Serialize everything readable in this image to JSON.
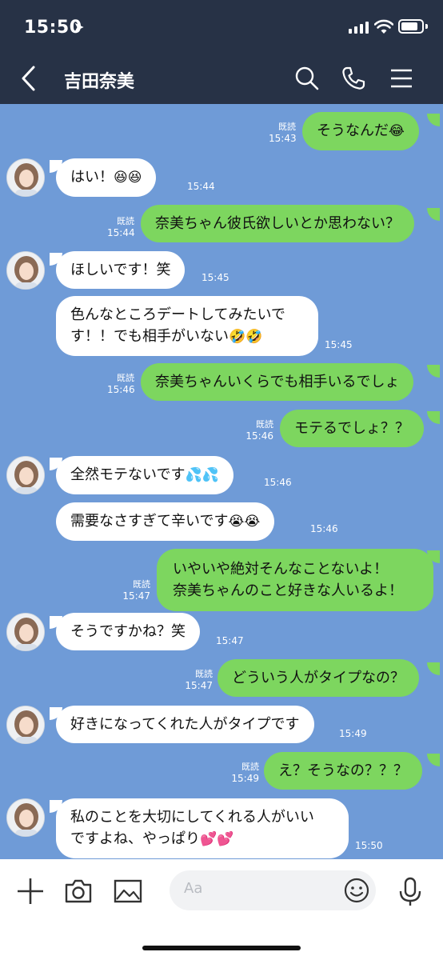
{
  "status_bar": {
    "time": "15:50"
  },
  "header": {
    "contact_name": "吉田奈美"
  },
  "messages": [
    {
      "dir": "out",
      "text": "そうなんだ",
      "emoji": "😂",
      "read": "既読",
      "time": "15:43"
    },
    {
      "dir": "in",
      "text": "はい！",
      "emoji": "😆😆",
      "time": "15:44"
    },
    {
      "dir": "out",
      "text": "奈美ちゃん彼氏欲しいとか思わない？",
      "emoji": "",
      "read": "既読",
      "time": "15:44"
    },
    {
      "dir": "in",
      "text": "ほしいです！笑",
      "emoji": "",
      "time": "15:45"
    },
    {
      "dir": "in",
      "line1": "色んなところデートしてみたいで",
      "line2": "す！！でも相手がいない",
      "emoji": "🤣🤣",
      "time": "15:45"
    },
    {
      "dir": "out",
      "text": "奈美ちゃんいくらでも相手いるでしょ",
      "emoji": "",
      "read": "既読",
      "time": "15:46"
    },
    {
      "dir": "out",
      "text": "モテるでしょ？？",
      "emoji": "",
      "read": "既読",
      "time": "15:46"
    },
    {
      "dir": "in",
      "text": "全然モテないです",
      "emoji": "💦💦",
      "time": "15:46"
    },
    {
      "dir": "in",
      "text": "需要なさすぎて辛いです",
      "emoji": "😭😭",
      "time": "15:46"
    },
    {
      "dir": "out",
      "line1": "いやいや絶対そんなことないよ！",
      "line2": "奈美ちゃんのこと好きな人いるよ！",
      "emoji": "",
      "read": "既読",
      "time": "15:47"
    },
    {
      "dir": "in",
      "text": "そうですかね？笑",
      "emoji": "",
      "time": "15:47"
    },
    {
      "dir": "out",
      "text": "どういう人がタイプなの？",
      "emoji": "",
      "read": "既読",
      "time": "15:47"
    },
    {
      "dir": "in",
      "text": "好きになってくれた人がタイプです",
      "emoji": "",
      "time": "15:49"
    },
    {
      "dir": "out",
      "text": "え？そうなの？？？",
      "emoji": "",
      "read": "既読",
      "time": "15:49"
    },
    {
      "dir": "in",
      "line1": "私のことを大切にしてくれる人がいい",
      "line2": "ですよね、やっぱり",
      "emoji": "💕💕",
      "time": "15:50"
    }
  ],
  "input": {
    "placeholder": "Aa"
  },
  "icons": {
    "back": "chevron-left-icon",
    "search": "search-icon",
    "call": "phone-icon",
    "menu": "hamburger-menu-icon",
    "plus": "plus-icon",
    "camera": "camera-icon",
    "image": "image-icon",
    "emoji": "smiley-icon",
    "mic": "microphone-icon"
  },
  "colors": {
    "header_bg": "#273246",
    "chat_bg": "#6f9bd7",
    "outgoing_bubble": "#7dd65f",
    "incoming_bubble": "#ffffff"
  }
}
